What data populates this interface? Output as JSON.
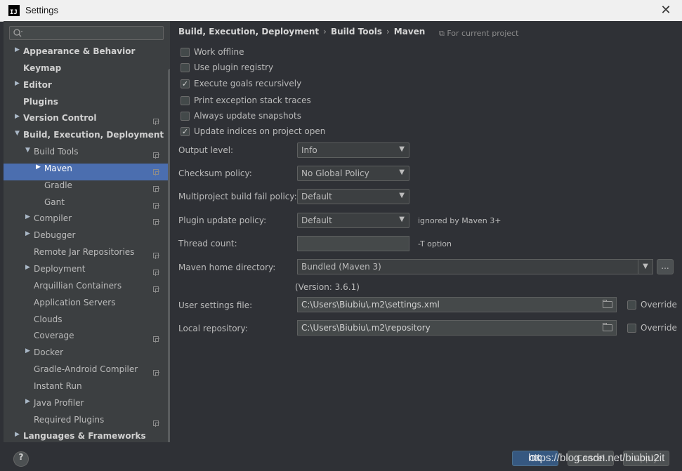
{
  "window": {
    "title": "Settings",
    "logo_text": "IJ"
  },
  "sidebar": {
    "search_placeholder": "",
    "items": [
      {
        "label": "Appearance & Behavior",
        "level": 0,
        "arrow": "right",
        "bold": true,
        "project": false,
        "selected": false
      },
      {
        "label": "Keymap",
        "level": 0,
        "arrow": "",
        "bold": true,
        "project": false,
        "selected": false
      },
      {
        "label": "Editor",
        "level": 0,
        "arrow": "right",
        "bold": true,
        "project": false,
        "selected": false
      },
      {
        "label": "Plugins",
        "level": 0,
        "arrow": "",
        "bold": true,
        "project": false,
        "selected": false
      },
      {
        "label": "Version Control",
        "level": 0,
        "arrow": "right",
        "bold": true,
        "project": true,
        "selected": false
      },
      {
        "label": "Build, Execution, Deployment",
        "level": 0,
        "arrow": "down",
        "bold": true,
        "project": false,
        "selected": false
      },
      {
        "label": "Build Tools",
        "level": 1,
        "arrow": "down",
        "bold": false,
        "project": true,
        "selected": false
      },
      {
        "label": "Maven",
        "level": 2,
        "arrow": "right",
        "bold": false,
        "project": true,
        "selected": true
      },
      {
        "label": "Gradle",
        "level": 2,
        "arrow": "",
        "bold": false,
        "project": true,
        "selected": false
      },
      {
        "label": "Gant",
        "level": 2,
        "arrow": "",
        "bold": false,
        "project": true,
        "selected": false
      },
      {
        "label": "Compiler",
        "level": 1,
        "arrow": "right",
        "bold": false,
        "project": true,
        "selected": false
      },
      {
        "label": "Debugger",
        "level": 1,
        "arrow": "right",
        "bold": false,
        "project": false,
        "selected": false
      },
      {
        "label": "Remote Jar Repositories",
        "level": 1,
        "arrow": "",
        "bold": false,
        "project": true,
        "selected": false
      },
      {
        "label": "Deployment",
        "level": 1,
        "arrow": "right",
        "bold": false,
        "project": true,
        "selected": false
      },
      {
        "label": "Arquillian Containers",
        "level": 1,
        "arrow": "",
        "bold": false,
        "project": true,
        "selected": false
      },
      {
        "label": "Application Servers",
        "level": 1,
        "arrow": "",
        "bold": false,
        "project": false,
        "selected": false
      },
      {
        "label": "Clouds",
        "level": 1,
        "arrow": "",
        "bold": false,
        "project": false,
        "selected": false
      },
      {
        "label": "Coverage",
        "level": 1,
        "arrow": "",
        "bold": false,
        "project": true,
        "selected": false
      },
      {
        "label": "Docker",
        "level": 1,
        "arrow": "right",
        "bold": false,
        "project": false,
        "selected": false
      },
      {
        "label": "Gradle-Android Compiler",
        "level": 1,
        "arrow": "",
        "bold": false,
        "project": true,
        "selected": false
      },
      {
        "label": "Instant Run",
        "level": 1,
        "arrow": "",
        "bold": false,
        "project": false,
        "selected": false
      },
      {
        "label": "Java Profiler",
        "level": 1,
        "arrow": "right",
        "bold": false,
        "project": false,
        "selected": false
      },
      {
        "label": "Required Plugins",
        "level": 1,
        "arrow": "",
        "bold": false,
        "project": true,
        "selected": false
      },
      {
        "label": "Languages & Frameworks",
        "level": 0,
        "arrow": "right",
        "bold": true,
        "project": false,
        "selected": false
      }
    ]
  },
  "breadcrumb": {
    "part1": "Build, Execution, Deployment",
    "part2": "Build Tools",
    "part3": "Maven",
    "separator": "›",
    "project_note": "For current project"
  },
  "checkboxes": {
    "work_offline": {
      "label": "Work offline",
      "checked": false
    },
    "plugin_registry": {
      "label": "Use plugin registry",
      "checked": false
    },
    "goals_recursive": {
      "label": "Execute goals recursively",
      "checked": true
    },
    "stack_traces": {
      "label": "Print exception stack traces",
      "checked": false
    },
    "update_snapshots": {
      "label": "Always update snapshots",
      "checked": false
    },
    "update_indices": {
      "label": "Update indices on project open",
      "checked": true
    }
  },
  "form": {
    "output_level": {
      "label": "Output level:",
      "value": "Info"
    },
    "checksum_policy": {
      "label": "Checksum policy:",
      "value": "No Global Policy"
    },
    "fail_policy": {
      "label": "Multiproject build fail policy:",
      "value": "Default"
    },
    "plugin_update": {
      "label": "Plugin update policy:",
      "value": "Default",
      "hint": "ignored by Maven 3+"
    },
    "thread_count": {
      "label": "Thread count:",
      "value": "",
      "hint": "-T option"
    },
    "maven_home": {
      "label": "Maven home directory:",
      "value": "Bundled (Maven 3)",
      "browse": "...",
      "version": "(Version: 3.6.1)"
    },
    "user_settings": {
      "label": "User settings file:",
      "value": "C:\\Users\\Biubiu\\.m2\\settings.xml",
      "override": "Override"
    },
    "local_repo": {
      "label": "Local repository:",
      "value": "C:\\Users\\Biubiu\\.m2\\repository",
      "override": "Override"
    }
  },
  "footer": {
    "help": "?",
    "ok": "OK",
    "cancel": "Cancel",
    "apply": "Apply",
    "watermark": "https://blog.csdn.net/biubiu2it"
  },
  "colors": {
    "selection": "#4b6eaf",
    "sidebar_bg": "#3c3f41",
    "main_bg": "#2f3136"
  }
}
